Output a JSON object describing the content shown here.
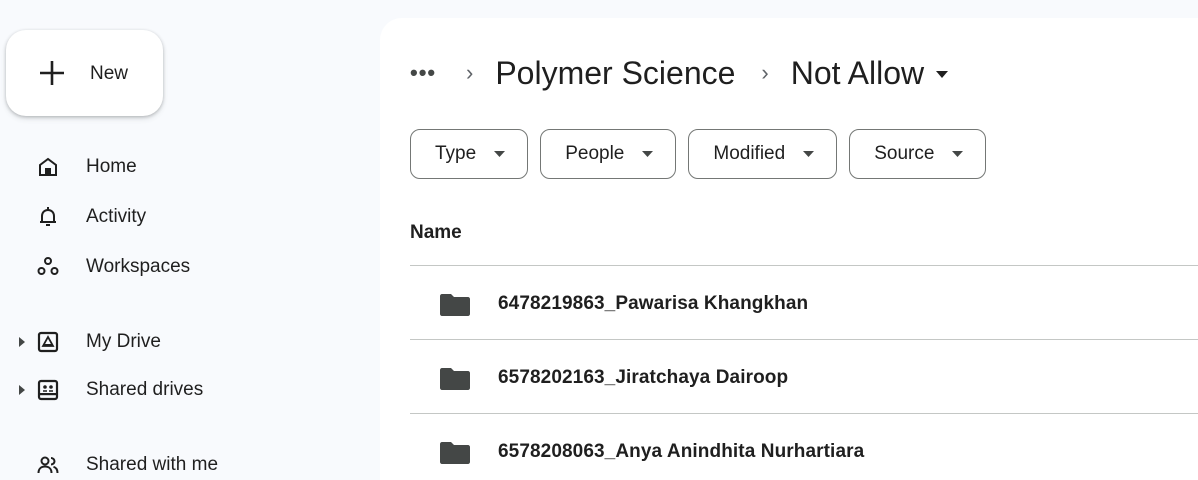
{
  "sidebar": {
    "new_label": "New",
    "items": [
      {
        "label": "Home",
        "icon": "home-icon"
      },
      {
        "label": "Activity",
        "icon": "bell-icon"
      },
      {
        "label": "Workspaces",
        "icon": "workspaces-icon"
      },
      {
        "label": "My Drive",
        "icon": "my-drive-icon"
      },
      {
        "label": "Shared drives",
        "icon": "shared-drives-icon"
      },
      {
        "label": "Shared with me",
        "icon": "shared-with-me-icon"
      }
    ]
  },
  "breadcrumb": {
    "more": "•••",
    "separator": "›",
    "parent": "Polymer Science",
    "current": "Not Allow"
  },
  "filters": [
    {
      "label": "Type"
    },
    {
      "label": "People"
    },
    {
      "label": "Modified"
    },
    {
      "label": "Source"
    }
  ],
  "table": {
    "column_name": "Name",
    "rows": [
      {
        "name": "6478219863_Pawarisa Khangkhan"
      },
      {
        "name": "6578202163_Jiratchaya Dairoop"
      },
      {
        "name": "6578208063_Anya Anindhita Nurhartiara"
      }
    ]
  },
  "colors": {
    "background": "#f8fafd",
    "surface": "#ffffff",
    "text": "#1f1f1f",
    "folder": "#444746"
  }
}
